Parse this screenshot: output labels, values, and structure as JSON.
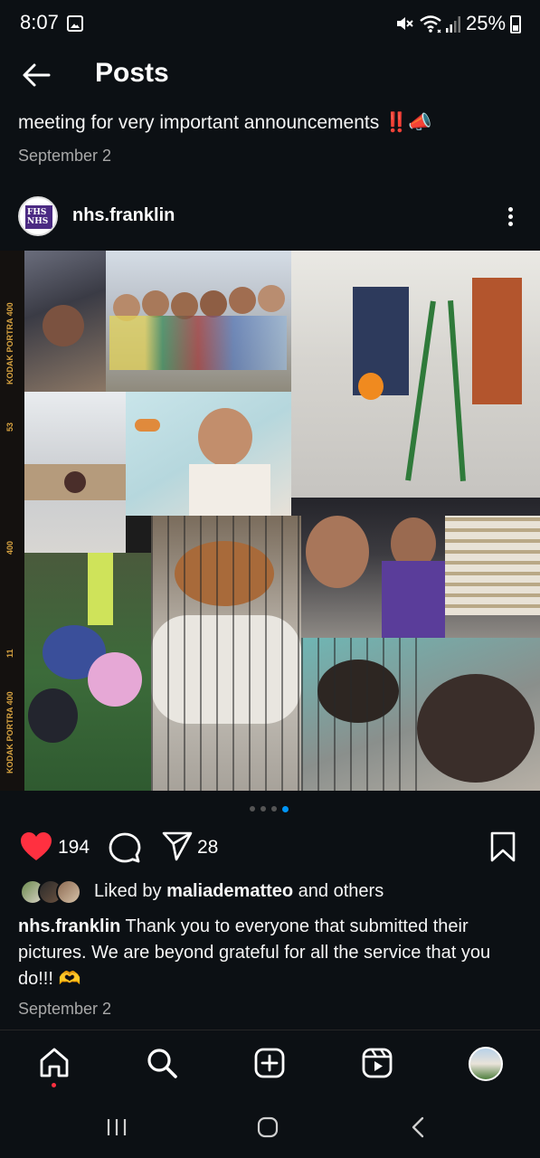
{
  "status_bar": {
    "time": "8:07",
    "battery": "25%",
    "icons": [
      "gallery-icon",
      "mute-icon",
      "wifi-icon",
      "signal-icon",
      "battery-icon"
    ]
  },
  "header": {
    "title": "Posts",
    "back_icon": "arrow-left-icon"
  },
  "previous_post": {
    "caption": "meeting for very important announcements ‼️📣",
    "date": "September 2"
  },
  "post": {
    "username": "nhs.franklin",
    "avatar_text": "FHS NHS",
    "photo_text": {
      "film_1": "KODAK PORTRA 400",
      "film_2": "53",
      "film_3": "400",
      "film_4": "11",
      "film_5": "KODAK PORTRA 400"
    },
    "carousel": {
      "count": 4,
      "active_index": 3
    },
    "likes": "194",
    "shares": "28",
    "liked_by_prefix": "Liked by ",
    "liked_by_user": "maliadematteo",
    "liked_by_suffix": " and others",
    "caption_user": "nhs.franklin",
    "caption_text": " Thank you to everyone that submitted their pictures. We are beyond grateful for all the service that you do!!! 🫶",
    "date": "September 2"
  },
  "colors": {
    "background": "#0c1014",
    "like_red": "#ff3040",
    "active_dot": "#0095f6",
    "secondary_text": "#a8a8a8"
  },
  "bottom_nav": {
    "items": [
      "home-icon",
      "search-icon",
      "create-icon",
      "reels-icon",
      "profile-avatar"
    ]
  },
  "system_nav": {
    "items": [
      "recent-apps-icon",
      "home-circle-icon",
      "back-chevron-icon"
    ]
  }
}
